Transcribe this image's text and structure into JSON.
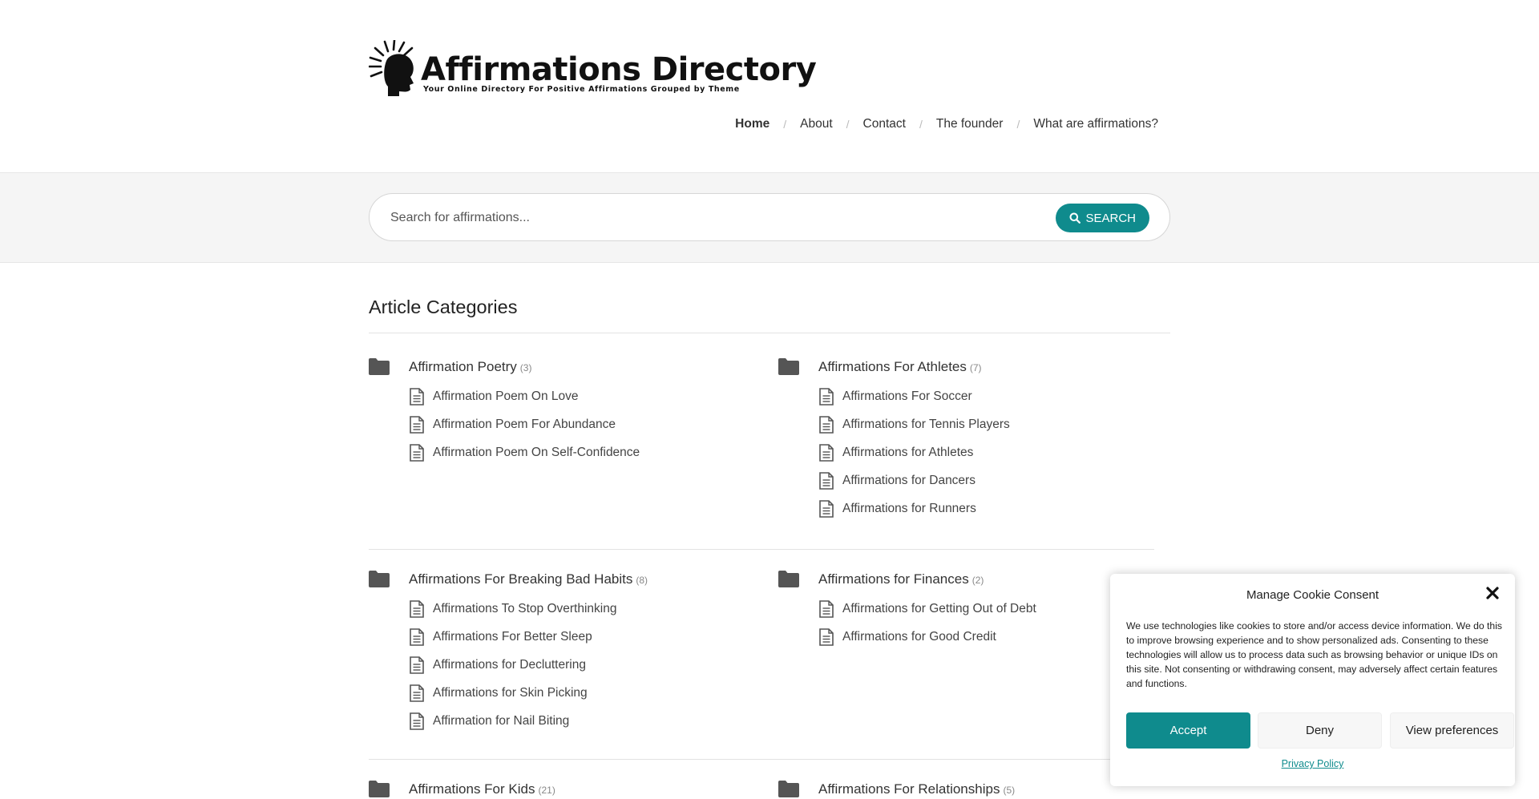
{
  "site": {
    "title": "Affirmations Directory",
    "tagline": "Your Online Directory For Positive Affirmations Grouped by Theme",
    "icon": "head-sunburst-logo-icon"
  },
  "nav": {
    "items": [
      {
        "label": "Home",
        "active": true
      },
      {
        "label": "About"
      },
      {
        "label": "Contact"
      },
      {
        "label": "The founder"
      },
      {
        "label": "What are affirmations?"
      }
    ],
    "separator": "/"
  },
  "search": {
    "placeholder": "Search for affirmations...",
    "button_label": "SEARCH",
    "button_icon": "search-icon"
  },
  "section_title": "Article Categories",
  "colors": {
    "accent": "#0f8b8d",
    "band": "#f5f5f5"
  },
  "categories": [
    {
      "title": "Affirmation Poetry",
      "count": "(3)",
      "articles": [
        "Affirmation Poem On Love",
        "Affirmation Poem For Abundance",
        "Affirmation Poem On Self-Confidence"
      ]
    },
    {
      "title": "Affirmations For Athletes",
      "count": "(7)",
      "articles": [
        "Affirmations For Soccer",
        "Affirmations for Tennis Players",
        "Affirmations for Athletes",
        "Affirmations for Dancers",
        "Affirmations for Runners"
      ]
    },
    {
      "title": "Affirmations For Breaking Bad Habits",
      "count": "(8)",
      "articles": [
        "Affirmations To Stop Overthinking",
        "Affirmations For Better Sleep",
        "Affirmations for Decluttering",
        "Affirmations for Skin Picking",
        "Affirmation for Nail Biting"
      ]
    },
    {
      "title": "Affirmations for Finances",
      "count": "(2)",
      "articles": [
        "Affirmations for Getting Out of Debt",
        "Affirmations for Good Credit"
      ]
    },
    {
      "title": "Affirmations For Kids",
      "count": "(21)",
      "articles": []
    },
    {
      "title": "Affirmations For Relationships",
      "count": "(5)",
      "articles": []
    }
  ],
  "cookie": {
    "title": "Manage Cookie Consent",
    "text": "We use technologies like cookies to store and/or access device information. We do this to improve browsing experience and to show personalized ads. Consenting to these technologies will allow us to process data such as browsing behavior or unique IDs on this site. Not consenting or withdrawing consent, may adversely affect certain features and functions.",
    "accept": "Accept",
    "deny": "Deny",
    "preferences": "View preferences",
    "privacy": "Privacy Policy"
  }
}
